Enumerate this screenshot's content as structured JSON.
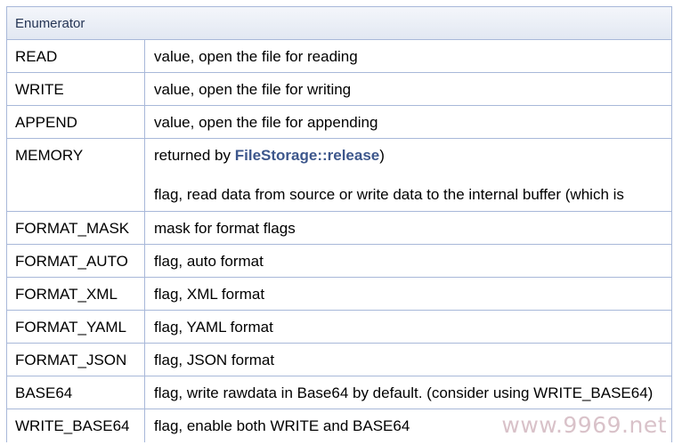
{
  "table": {
    "header": "Enumerator",
    "rows": [
      {
        "name": "READ",
        "desc": "value, open the file for reading"
      },
      {
        "name": "WRITE",
        "desc": "value, open the file for writing"
      },
      {
        "name": "APPEND",
        "desc": "value, open the file for appending"
      },
      {
        "name": "MEMORY",
        "desc_prefix": "returned by ",
        "link": "FileStorage::release",
        "desc_suffix": ")",
        "desc_line2": "flag, read data from source or write data to the internal buffer (which is"
      },
      {
        "name": "FORMAT_MASK",
        "desc": "mask for format flags"
      },
      {
        "name": "FORMAT_AUTO",
        "desc": "flag, auto format"
      },
      {
        "name": "FORMAT_XML",
        "desc": "flag, XML format"
      },
      {
        "name": "FORMAT_YAML",
        "desc": "flag, YAML format"
      },
      {
        "name": "FORMAT_JSON",
        "desc": "flag, JSON format"
      },
      {
        "name": "BASE64",
        "desc": "flag, write rawdata in Base64 by default. (consider using WRITE_BASE64)"
      },
      {
        "name": "WRITE_BASE64",
        "desc": "flag, enable both WRITE and BASE64"
      }
    ]
  },
  "watermark": "www.9969.net",
  "colors": {
    "border": "#a8b8d9",
    "header_bg": "#e2e8f2",
    "link": "#3d578c",
    "watermark": "#d9c2c9"
  }
}
